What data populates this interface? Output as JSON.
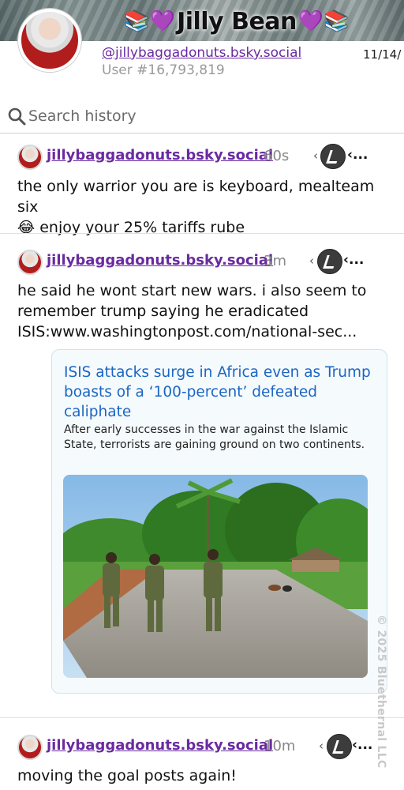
{
  "profile": {
    "title_emoji_left": "📚💜",
    "display_name": "Jilly Bean",
    "title_emoji_right": "💜📚",
    "handle": "@jillybaggadonuts.bsky.social",
    "user_number": "User #16,793,819",
    "date": "11/14/"
  },
  "search": {
    "placeholder": "Search history"
  },
  "posts": [
    {
      "handle": "jillybaggadonuts.bsky.social",
      "time": "60s",
      "text_line1": "the only warrior you are is keyboard, mealteam six",
      "text_line2": "😂 enjoy your 25% tariffs rube"
    },
    {
      "handle": "jillybaggadonuts.bsky.social",
      "time": "3m",
      "text_line1": "he said he wont start new wars. i also seem to",
      "text_line2": "remember trump saying he eradicated",
      "text_line3": "ISIS:www.washingtonpost.com/national-sec...",
      "card": {
        "title": "ISIS attacks surge in Africa even as Trump boasts of a ‘100-percent’ defeated caliphate",
        "description": "After early successes in the war against the Islamic State, terrorists are gaining ground on two continents."
      }
    },
    {
      "handle": "jillybaggadonuts.bsky.social",
      "time": "10m",
      "text_line1": "moving the goal posts again!"
    }
  ],
  "controls": {
    "prev_glyph": "‹",
    "more_glyph": "‹..."
  },
  "watermark": "© 2025 Bluethernal LLC",
  "colors": {
    "handle_purple": "#6a2aa0",
    "link_blue": "#1b66c4",
    "card_border": "#cfe3ef"
  },
  "icons": [
    "search-icon",
    "bot-avatar-icon",
    "profile-avatar"
  ]
}
